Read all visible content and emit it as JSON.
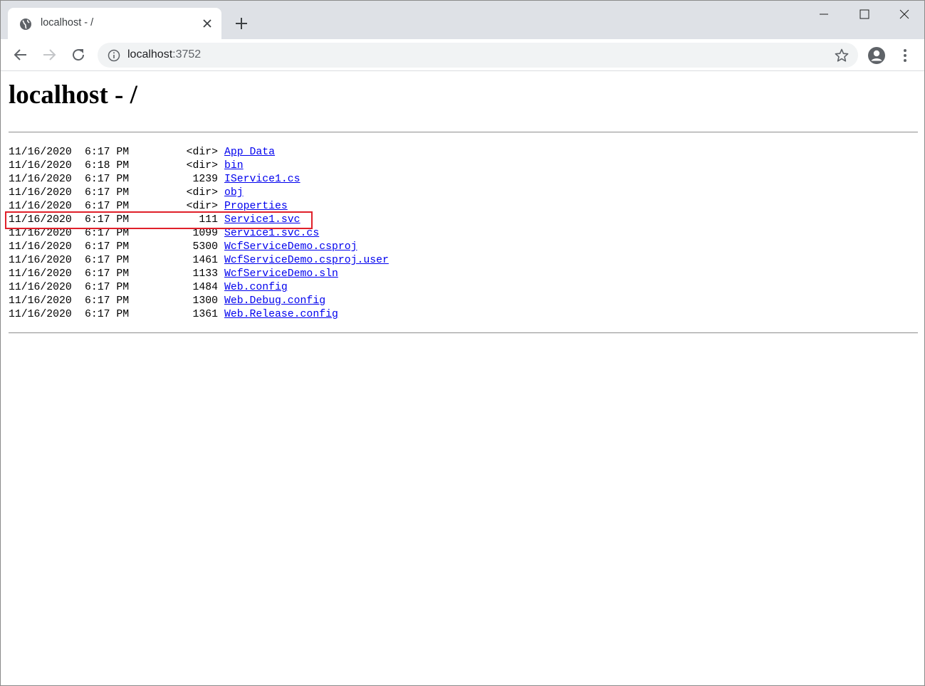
{
  "browser": {
    "tab_title": "localhost - /",
    "url_host": "localhost",
    "url_port": ":3752"
  },
  "page": {
    "title": "localhost - /",
    "entries": [
      {
        "date": "11/16/2020",
        "time": "6:17 PM",
        "size": "<dir>",
        "name": "App_Data"
      },
      {
        "date": "11/16/2020",
        "time": "6:18 PM",
        "size": "<dir>",
        "name": "bin"
      },
      {
        "date": "11/16/2020",
        "time": "6:17 PM",
        "size": "1239",
        "name": "IService1.cs"
      },
      {
        "date": "11/16/2020",
        "time": "6:17 PM",
        "size": "<dir>",
        "name": "obj"
      },
      {
        "date": "11/16/2020",
        "time": "6:17 PM",
        "size": "<dir>",
        "name": "Properties"
      },
      {
        "date": "11/16/2020",
        "time": "6:17 PM",
        "size": "111",
        "name": "Service1.svc"
      },
      {
        "date": "11/16/2020",
        "time": "6:17 PM",
        "size": "1099",
        "name": "Service1.svc.cs"
      },
      {
        "date": "11/16/2020",
        "time": "6:17 PM",
        "size": "5300",
        "name": "WcfServiceDemo.csproj"
      },
      {
        "date": "11/16/2020",
        "time": "6:17 PM",
        "size": "1461",
        "name": "WcfServiceDemo.csproj.user"
      },
      {
        "date": "11/16/2020",
        "time": "6:17 PM",
        "size": "1133",
        "name": "WcfServiceDemo.sln"
      },
      {
        "date": "11/16/2020",
        "time": "6:17 PM",
        "size": "1484",
        "name": "Web.config"
      },
      {
        "date": "11/16/2020",
        "time": "6:17 PM",
        "size": "1300",
        "name": "Web.Debug.config"
      },
      {
        "date": "11/16/2020",
        "time": "6:17 PM",
        "size": "1361",
        "name": "Web.Release.config"
      }
    ],
    "highlighted_entry": "Service1.svc"
  },
  "colors": {
    "link": "#0000ee",
    "highlight_border": "#e0202a",
    "tabstrip": "#dee1e6",
    "omnibox": "#f1f3f4"
  },
  "icons": [
    "globe-icon",
    "close-icon",
    "plus-icon",
    "minimize-icon",
    "maximize-icon",
    "window-close-icon",
    "back-arrow-icon",
    "forward-arrow-icon",
    "reload-icon",
    "info-icon",
    "star-icon",
    "profile-icon",
    "kebab-menu-icon"
  ]
}
